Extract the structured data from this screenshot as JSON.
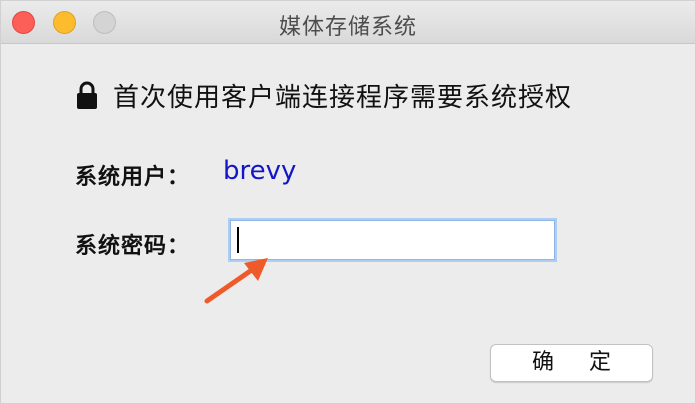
{
  "window": {
    "title": "媒体存储系统"
  },
  "dialog": {
    "prompt": "首次使用客户端连接程序需要系统授权",
    "lock_icon": "lock-icon",
    "user_label": "系统用户：",
    "username": "brevy",
    "password_label": "系统密码：",
    "password_value": "",
    "ok_label": "确 定"
  },
  "colors": {
    "close": "#fc5f57",
    "minimize": "#fdbc2e",
    "zoom": "#d4d4d4",
    "username": "#1515c8",
    "arrow": "#ee5a2a",
    "input_focus": "#aecdf2"
  }
}
